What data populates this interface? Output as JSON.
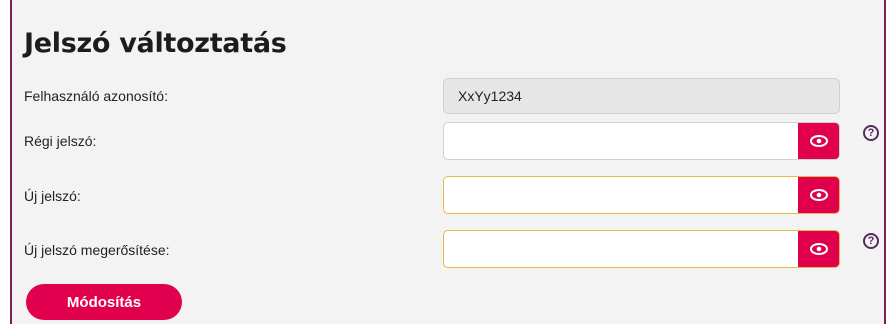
{
  "form": {
    "title": "Jelszó változtatás",
    "user_id_label": "Felhasználó azonosító:",
    "user_id_value": "XxYy1234",
    "old_password_label": "Régi jelszó:",
    "new_password_label": "Új jelszó:",
    "confirm_password_label": "Új jelszó megerősítése:",
    "help_glyph": "?",
    "submit_label": "Módosítás"
  },
  "colors": {
    "accent": "#e0004d",
    "panel_border": "#7a1f5c",
    "warning_border": "#e8b84a",
    "help_icon": "#5a2a5f"
  },
  "icons": {
    "toggle_visibility": "eye-icon",
    "help": "question-circle-icon"
  }
}
